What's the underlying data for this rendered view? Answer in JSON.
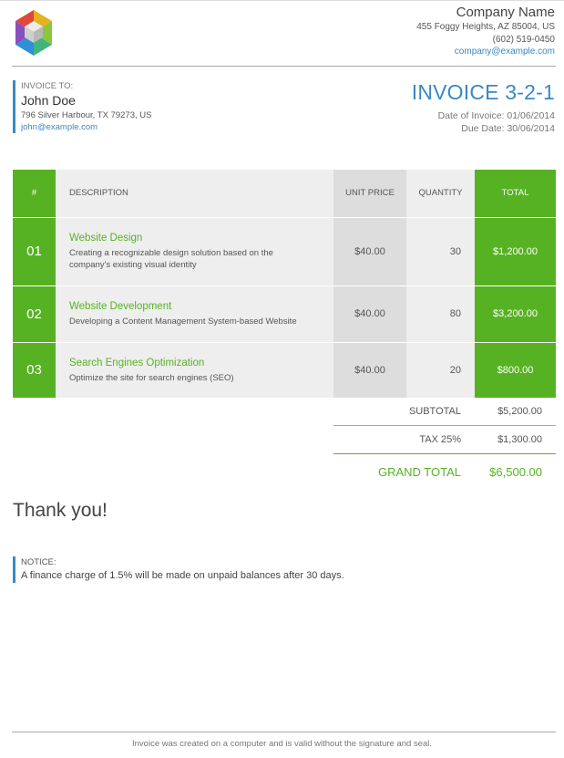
{
  "colors": {
    "accent_blue": "#3989c6",
    "accent_green": "#57b223",
    "text": "#555555"
  },
  "company": {
    "name": "Company Name",
    "address": "455 Foggy Heights, AZ 85004, US",
    "phone": "(602) 519-0450",
    "email": "company@example.com",
    "logo_icon": "hexagon-cube-logo-icon"
  },
  "client": {
    "label": "INVOICE TO:",
    "name": "John Doe",
    "address": "796 Silver Harbour, TX 79273, US",
    "email": "john@example.com"
  },
  "invoice": {
    "id": "INVOICE 3-2-1",
    "date": "Date of Invoice: 01/06/2014",
    "due": "Due Date: 30/06/2014"
  },
  "table": {
    "headers": {
      "no": "#",
      "description": "DESCRIPTION",
      "unit_price": "UNIT PRICE",
      "quantity": "QUANTITY",
      "total": "TOTAL"
    },
    "rows": [
      {
        "no": "01",
        "title": "Website Design",
        "desc": "Creating a recognizable design solution based on the company's existing visual identity",
        "unit_price": "$40.00",
        "quantity": "30",
        "total": "$1,200.00"
      },
      {
        "no": "02",
        "title": "Website Development",
        "desc": "Developing a Content Management System-based Website",
        "unit_price": "$40.00",
        "quantity": "80",
        "total": "$3,200.00"
      },
      {
        "no": "03",
        "title": "Search Engines Optimization",
        "desc": "Optimize the site for search engines (SEO)",
        "unit_price": "$40.00",
        "quantity": "20",
        "total": "$800.00"
      }
    ]
  },
  "totals": {
    "subtotal_label": "SUBTOTAL",
    "subtotal": "$5,200.00",
    "tax_label": "TAX 25%",
    "tax": "$1,300.00",
    "grand_label": "GRAND TOTAL",
    "grand": "$6,500.00"
  },
  "thanks": "Thank you!",
  "notice": {
    "label": "NOTICE:",
    "text": "A finance charge of 1.5% will be made on unpaid balances after 30 days."
  },
  "footer": "Invoice was created on a computer and is valid without the signature and seal."
}
